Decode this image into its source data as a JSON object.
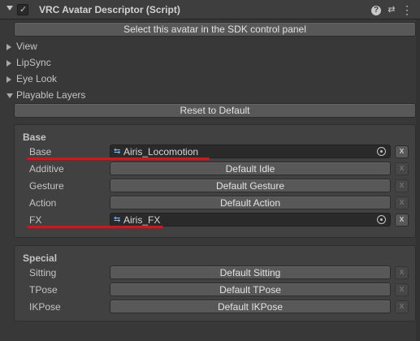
{
  "header": {
    "title": "VRC Avatar Descriptor (Script)",
    "checkbox_mark": "✓",
    "icons": [
      "help-icon",
      "presets-icon",
      "menu-icon"
    ],
    "help_glyph": "?",
    "presets_glyph": "⇄",
    "menu_glyph": "⋮"
  },
  "sdk_button": "Select this avatar in the SDK control panel",
  "foldouts": [
    {
      "label": "View",
      "open": false
    },
    {
      "label": "LipSync",
      "open": false
    },
    {
      "label": "Eye Look",
      "open": false
    },
    {
      "label": "Playable Layers",
      "open": true
    }
  ],
  "reset_button": "Reset to Default",
  "base_group": {
    "title": "Base",
    "rows": [
      {
        "label": "Base",
        "type": "object",
        "value": "Airis_Locomotion",
        "x": "x",
        "highlighted": true
      },
      {
        "label": "Additive",
        "type": "button",
        "value": "Default Idle",
        "x": "x",
        "highlighted": false
      },
      {
        "label": "Gesture",
        "type": "button",
        "value": "Default Gesture",
        "x": "x",
        "highlighted": false
      },
      {
        "label": "Action",
        "type": "button",
        "value": "Default Action",
        "x": "x",
        "highlighted": false
      },
      {
        "label": "FX",
        "type": "object",
        "value": "Airis_FX",
        "x": "x",
        "highlighted": true
      }
    ]
  },
  "special_group": {
    "title": "Special",
    "rows": [
      {
        "label": "Sitting",
        "type": "button",
        "value": "Default Sitting",
        "x": "x"
      },
      {
        "label": "TPose",
        "type": "button",
        "value": "Default TPose",
        "x": "x"
      },
      {
        "label": "IKPose",
        "type": "button",
        "value": "Default IKPose",
        "x": "x"
      }
    ]
  },
  "colors": {
    "background": "#383838",
    "highlight_underline": "#e0101a",
    "controller_icon": "#7cc2ff"
  }
}
